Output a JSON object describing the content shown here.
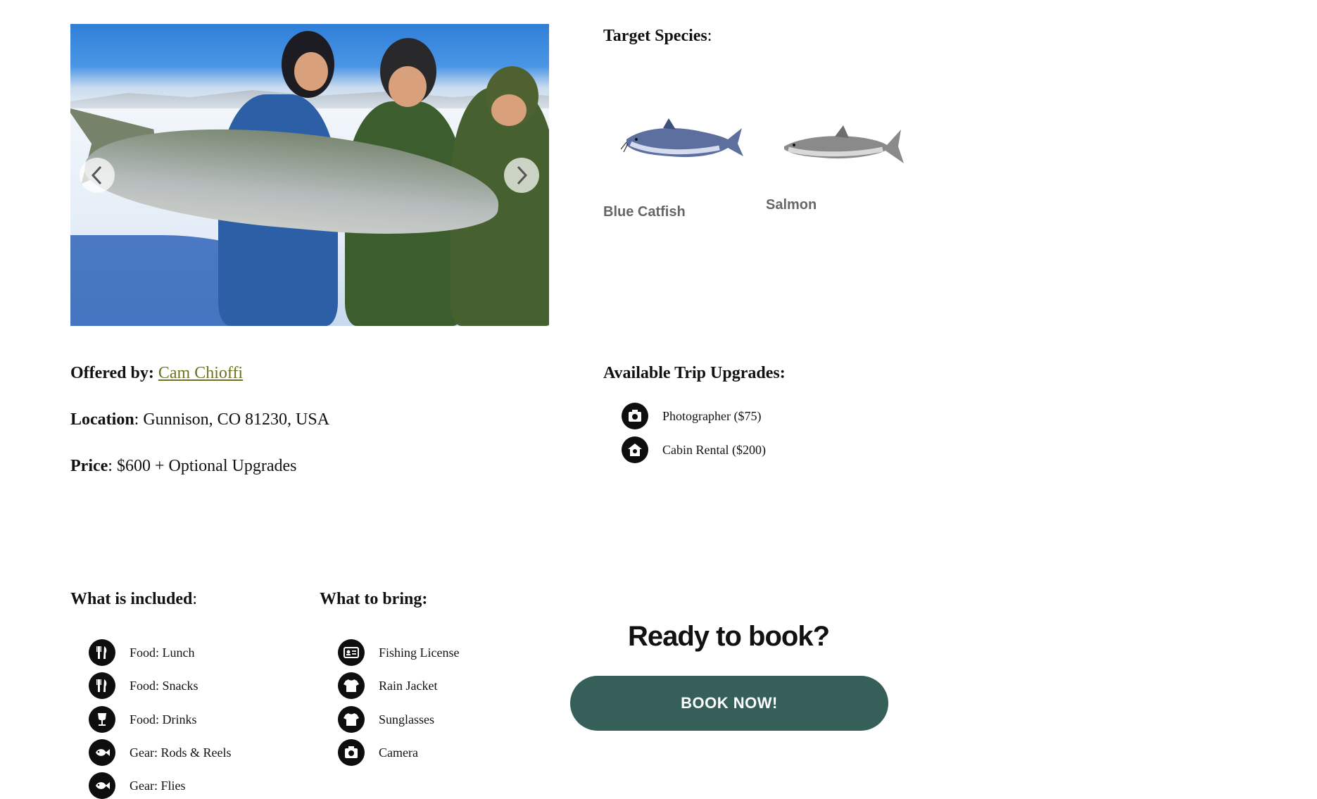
{
  "carousel": {
    "photo_alt": "Three anglers holding a large lake trout on a frozen lake",
    "prev_icon": "chevron-left-icon",
    "next_icon": "chevron-right-icon"
  },
  "species": {
    "heading_label": "Target Species",
    "heading_colon": ":",
    "items": [
      {
        "name": "Blue Catfish",
        "color": "#3a4f8a"
      },
      {
        "name": "Salmon",
        "color": "#7a7a7a"
      }
    ]
  },
  "info": {
    "offered_label": "Offered by:",
    "offered_name": "Cam Chioffi",
    "location_label": "Location",
    "location_value": ": Gunnison, CO 81230, USA",
    "price_label": "Price",
    "price_value": ": $600 + Optional Upgrades"
  },
  "upgrades": {
    "heading": "Available Trip Upgrades:",
    "items": [
      {
        "icon": "camera-icon",
        "label": "Photographer ($75)"
      },
      {
        "icon": "house-icon",
        "label": "Cabin Rental ($200)"
      }
    ]
  },
  "included": {
    "heading_label": "What is included",
    "heading_colon": ":",
    "items": [
      {
        "icon": "utensils-icon",
        "label": "Food: Lunch"
      },
      {
        "icon": "utensils-icon",
        "label": "Food: Snacks"
      },
      {
        "icon": "wine-glass-icon",
        "label": "Food: Drinks"
      },
      {
        "icon": "fish-icon",
        "label": "Gear: Rods & Reels"
      },
      {
        "icon": "fish-icon",
        "label": "Gear: Flies"
      }
    ]
  },
  "bring": {
    "heading": "What to bring:",
    "items": [
      {
        "icon": "id-card-icon",
        "label": "Fishing License"
      },
      {
        "icon": "shirt-icon",
        "label": "Rain Jacket"
      },
      {
        "icon": "shirt-icon",
        "label": "Sunglasses"
      },
      {
        "icon": "camera-icon",
        "label": "Camera"
      }
    ]
  },
  "cta": {
    "heading": "Ready to book?",
    "button_label": "BOOK NOW!",
    "button_color": "#355f58"
  }
}
